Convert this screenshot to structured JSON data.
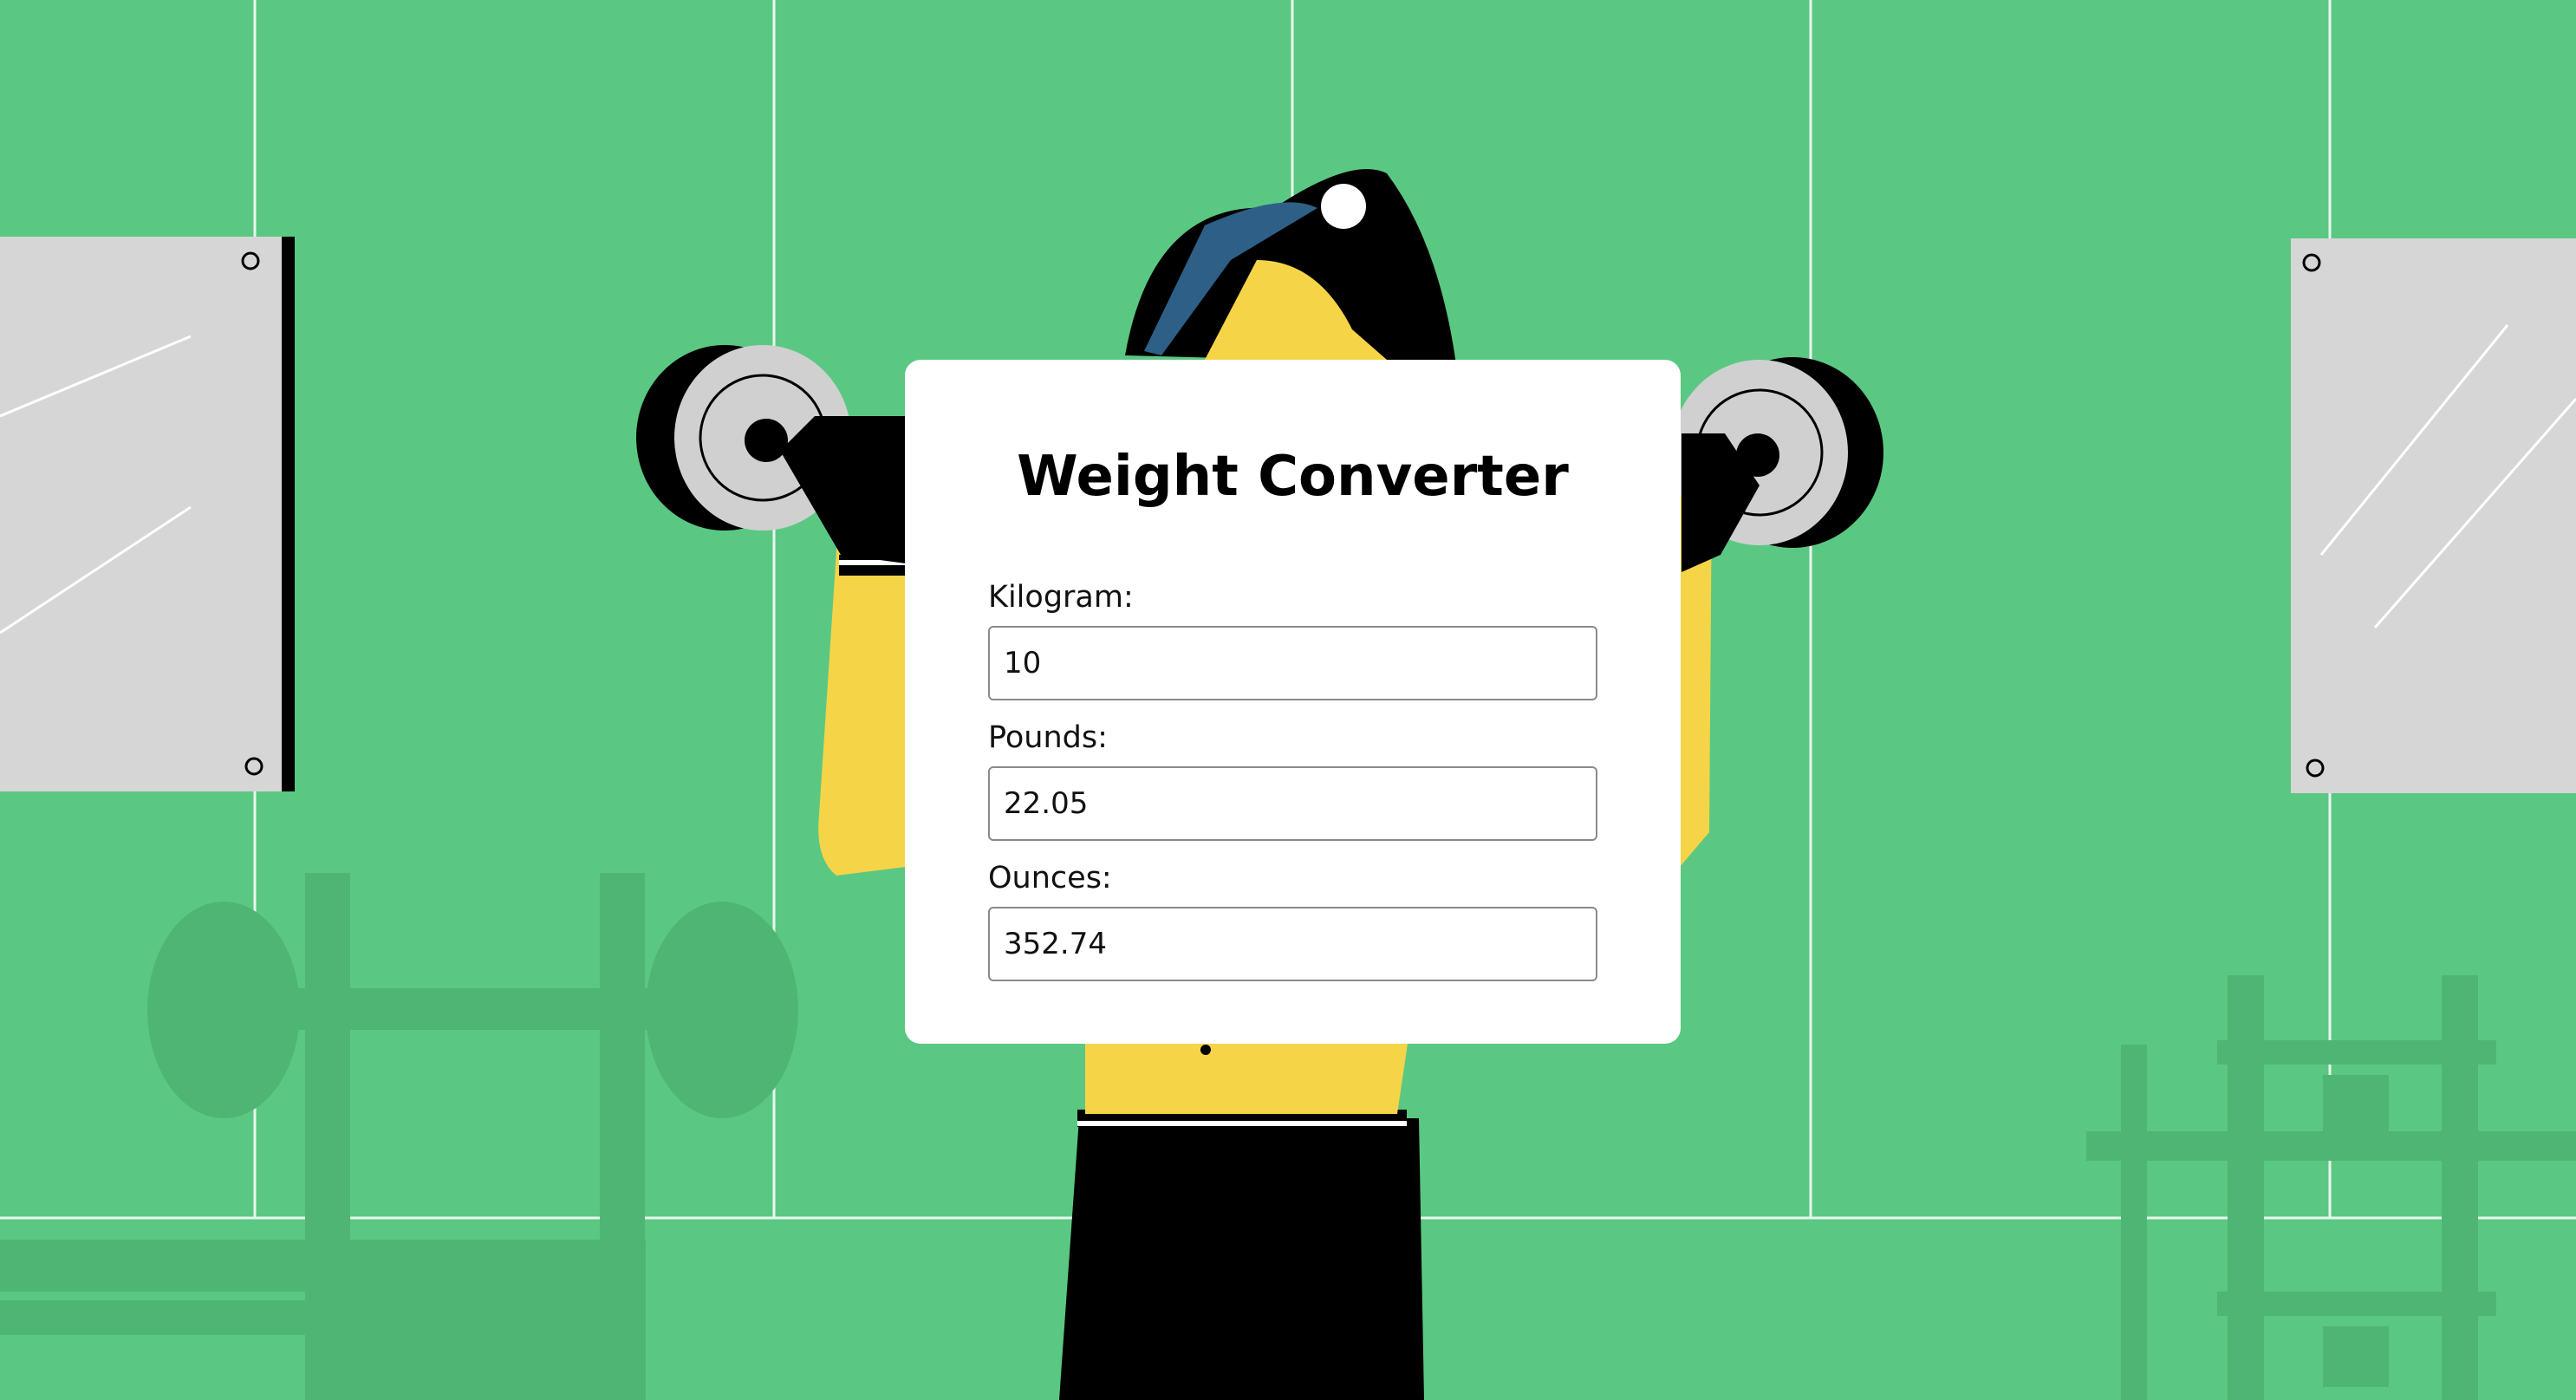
{
  "converter": {
    "title": "Weight Converter",
    "kilogram": {
      "label": "Kilogram:",
      "value": "10"
    },
    "pounds": {
      "label": "Pounds:",
      "value": "22.05"
    },
    "ounces": {
      "label": "Ounces:",
      "value": "352.74"
    }
  },
  "colors": {
    "background": "#5ac882",
    "card": "#ffffff",
    "skin": "#f5d547",
    "hair": "#000000",
    "equipment": "#4fb574"
  }
}
